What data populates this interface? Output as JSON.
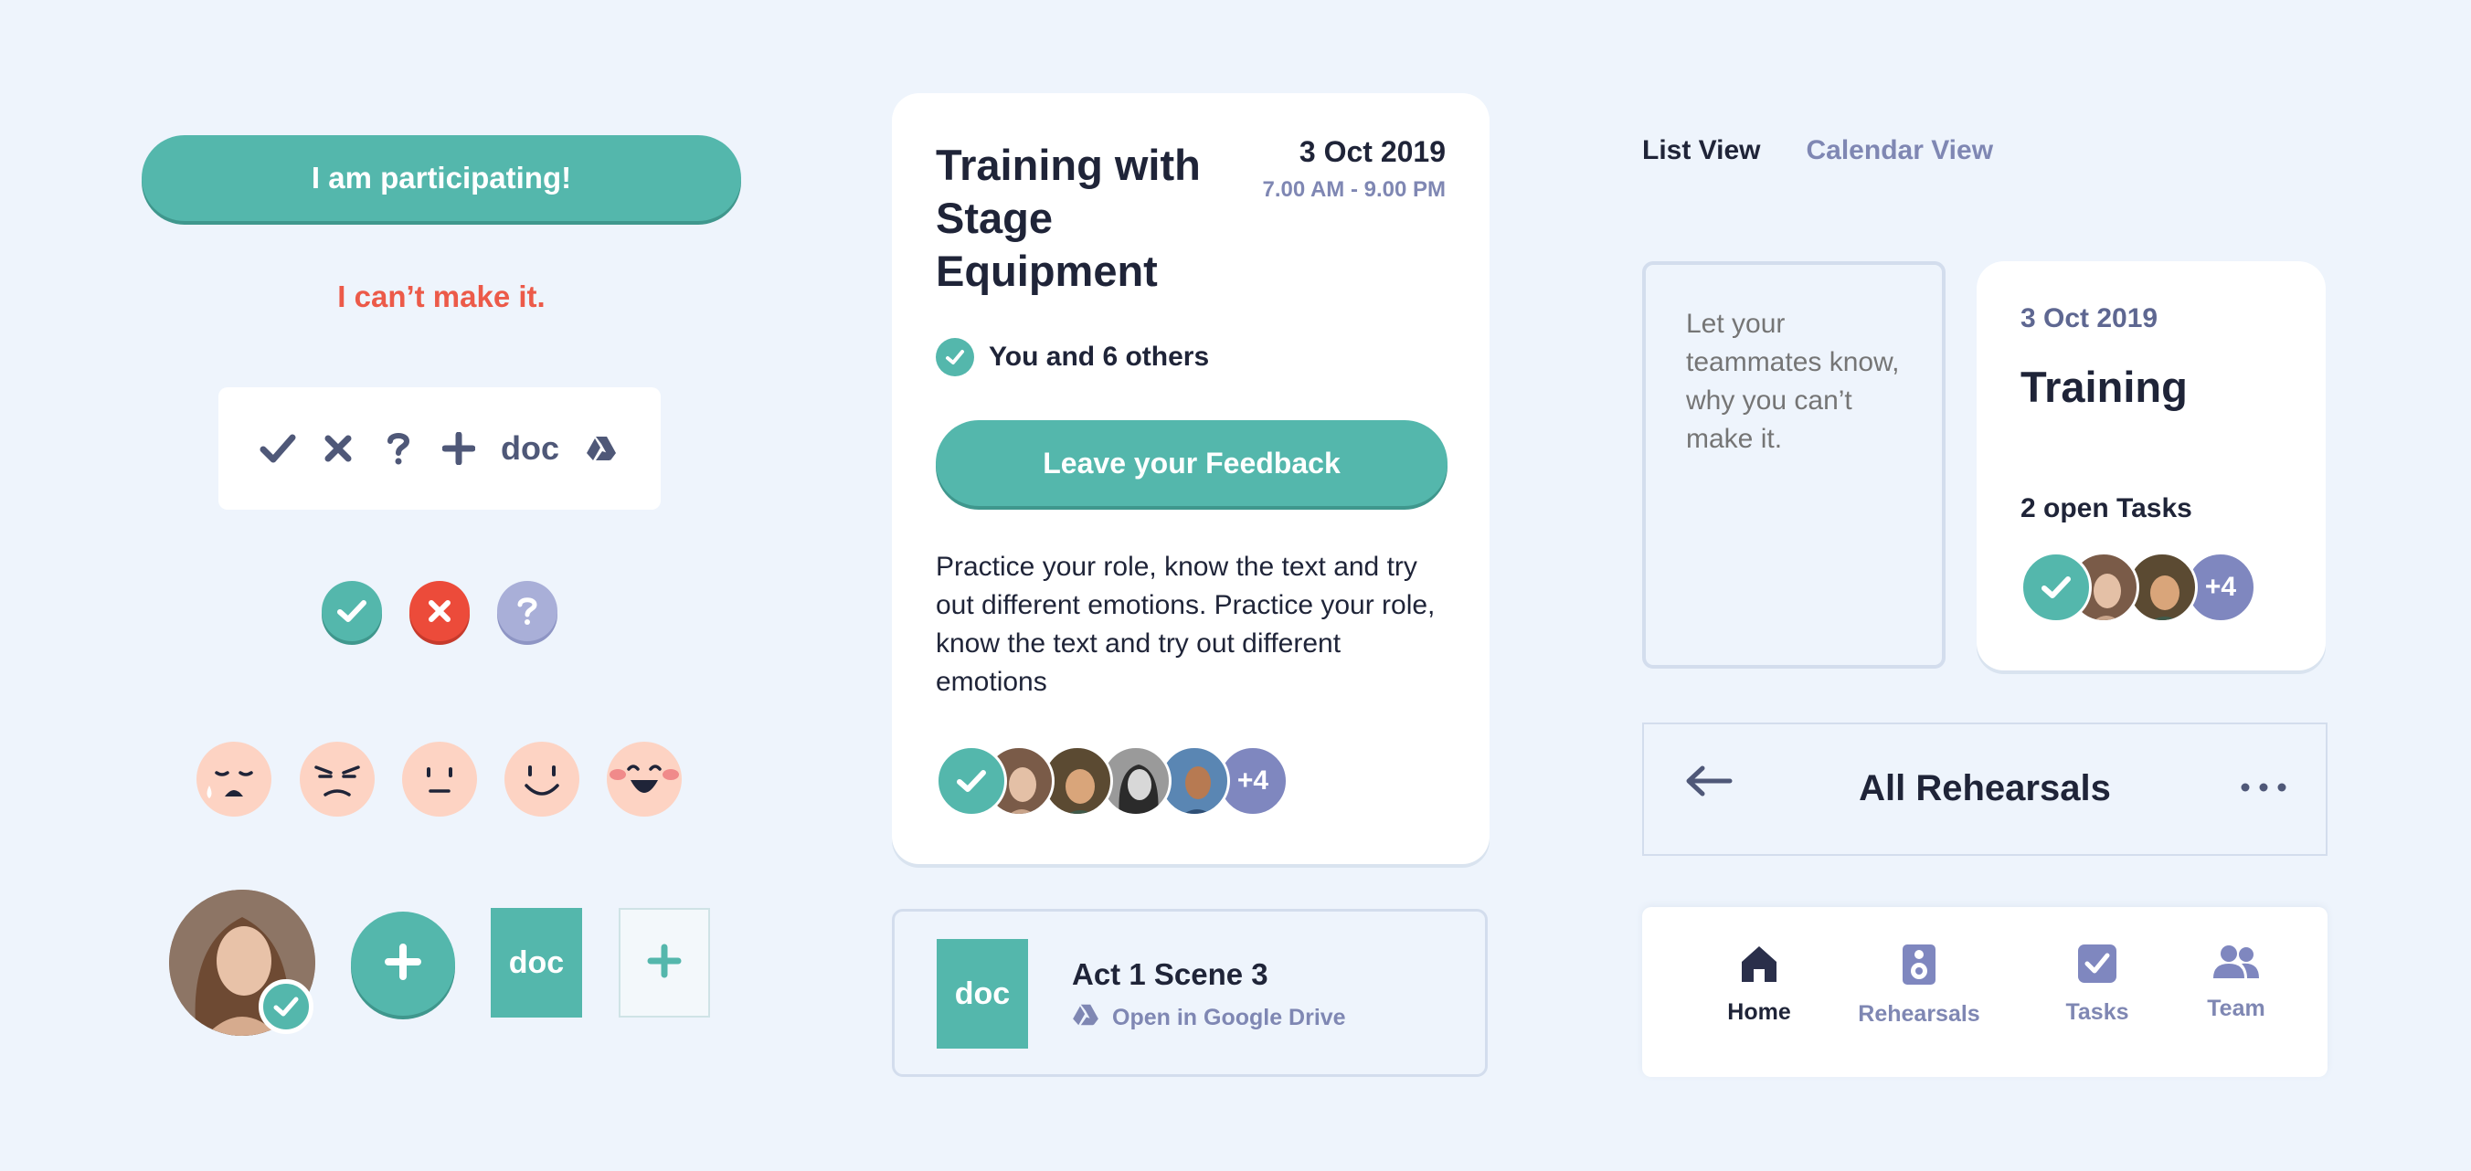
{
  "actions": {
    "participate_label": "I am participating!",
    "decline_label": "I can’t make it."
  },
  "icon_set": {
    "icons": [
      "check-icon",
      "close-icon",
      "question-icon",
      "plus-icon",
      "doc-icon",
      "google-drive-icon"
    ],
    "doc_label": "doc"
  },
  "status_icons": [
    "check",
    "cross",
    "question"
  ],
  "emotions": [
    "sad",
    "angry",
    "neutral",
    "smile",
    "laugh"
  ],
  "tiles": {
    "doc_label": "doc"
  },
  "event": {
    "title": "Training with Stage Equipment",
    "date": "3 Oct 2019",
    "time": "7.00 AM - 9.00 PM",
    "participants": "You and 6 others",
    "feedback_label": "Leave your Feedback",
    "description": "Practice your role, know the text and try out different emotions. Practice your role, know the text and try out different emotions",
    "more_count": "+4"
  },
  "file": {
    "doc_label": "doc",
    "name": "Act 1 Scene 3",
    "link_label": "Open in Google Drive"
  },
  "views": {
    "list": "List View",
    "calendar": "Calendar View"
  },
  "reason": {
    "placeholder": "Let your teammates know, why you can’t make it."
  },
  "summary": {
    "date": "3 Oct 2019",
    "title": "Training",
    "tasks": "2 open Tasks",
    "more_count": "+4"
  },
  "header": {
    "title": "All Rehearsals"
  },
  "nav": {
    "home": "Home",
    "rehearsals": "Rehearsals",
    "tasks": "Tasks",
    "team": "Team"
  },
  "colors": {
    "background": "#eef4fc",
    "primary": "#54b7ac",
    "danger": "#ec5a49",
    "muted": "#7f87b3",
    "text": "#1f2438",
    "emoji": "#fdd3c3"
  }
}
